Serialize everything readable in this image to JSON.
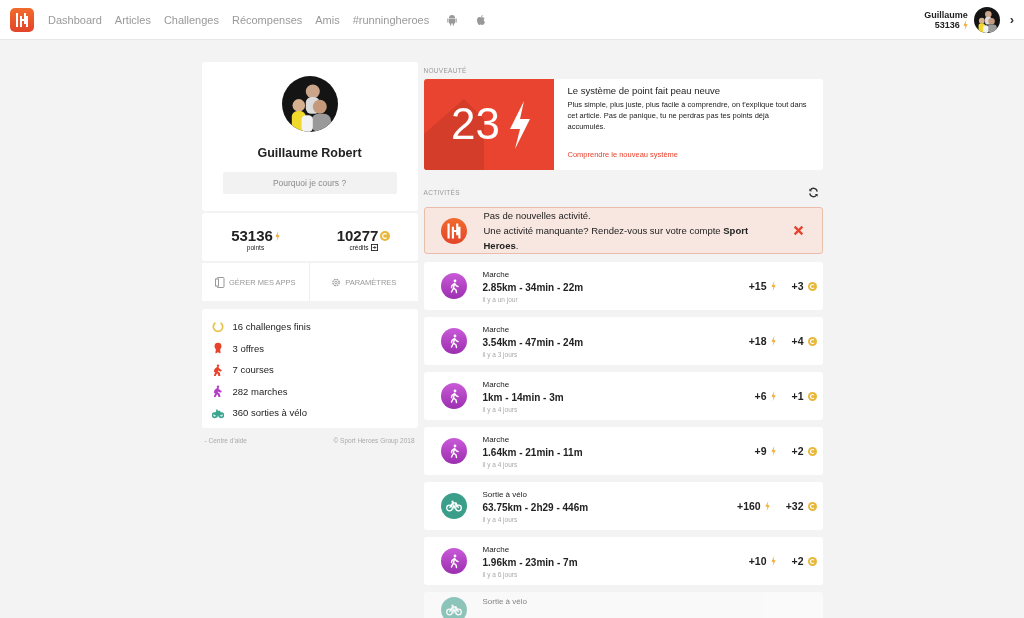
{
  "nav": {
    "links": [
      {
        "label": "Dashboard"
      },
      {
        "label": "Articles"
      },
      {
        "label": "Challenges"
      },
      {
        "label": "Récompenses"
      },
      {
        "label": "Amis"
      },
      {
        "label": "#runningheroes"
      }
    ],
    "user": {
      "name": "Guillaume",
      "points": "53136",
      "menu_glyph": "›"
    }
  },
  "profile": {
    "name": "Guillaume Robert",
    "motto_placeholder": "Pourquoi je cours ?",
    "points": {
      "value": "53136",
      "label": "points"
    },
    "credits": {
      "value": "10277",
      "label": "crédits"
    },
    "actions": [
      {
        "kind": "apps",
        "label": "GÉRER MES APPS"
      },
      {
        "kind": "settings",
        "label": "PARAMÈTRES"
      }
    ],
    "stats": [
      {
        "kind": "challenges",
        "label": "16 challenges finis",
        "color": "#e8c34a"
      },
      {
        "kind": "offers",
        "label": "3 offres",
        "color": "#e8412c"
      },
      {
        "kind": "runs",
        "label": "7 courses",
        "color": "#e8412c"
      },
      {
        "kind": "walks",
        "label": "282 marches",
        "color": "#b33fc4"
      },
      {
        "kind": "rides",
        "label": "360 sorties à vélo",
        "color": "#3aa58f"
      }
    ],
    "footer": {
      "help": "- Centre d'aide",
      "copyright": "© Sport Heroes Group 2018"
    }
  },
  "news": {
    "section_title": "NOUVEAUTÉ",
    "image_text": "23",
    "title": "Le système de point fait peau neuve",
    "body": "Plus simple, plus juste, plus facile à comprendre, on t'explique tout dans cet article. Pas de panique, tu ne perdras pas tes points déjà accumulés.",
    "link": "Comprendre le nouveau système"
  },
  "activities": {
    "section_title": "ACTIVITÉS",
    "alert": {
      "title": "Pas de nouvelles activité.",
      "text": "Une activité manquante? Rendez-vous sur votre compte **Sport Heroes**."
    },
    "items": [
      {
        "kind": "walk",
        "label": "Marche",
        "metrics": "2.85km - 34min - 22m",
        "time": "il y a un jour",
        "points": "+15",
        "credits": "+3",
        "faded": false
      },
      {
        "kind": "walk",
        "label": "Marche",
        "metrics": "3.54km - 47min - 24m",
        "time": "il y a 3 jours",
        "points": "+18",
        "credits": "+4",
        "faded": false
      },
      {
        "kind": "walk",
        "label": "Marche",
        "metrics": "1km - 14min - 3m",
        "time": "il y a 4 jours",
        "points": "+6",
        "credits": "+1",
        "faded": false
      },
      {
        "kind": "walk",
        "label": "Marche",
        "metrics": "1.64km - 21min - 11m",
        "time": "il y a 4 jours",
        "points": "+9",
        "credits": "+2",
        "faded": false
      },
      {
        "kind": "ride",
        "label": "Sortie à vélo",
        "metrics": "63.75km - 2h29 - 446m",
        "time": "il y a 4 jours",
        "points": "+160",
        "credits": "+32",
        "faded": false
      },
      {
        "kind": "walk",
        "label": "Marche",
        "metrics": "1.96km - 23min - 7m",
        "time": "il y a 6 jours",
        "points": "+10",
        "credits": "+2",
        "faded": false
      },
      {
        "kind": "ride",
        "label": "Sortie à vélo",
        "faded": true
      }
    ]
  }
}
